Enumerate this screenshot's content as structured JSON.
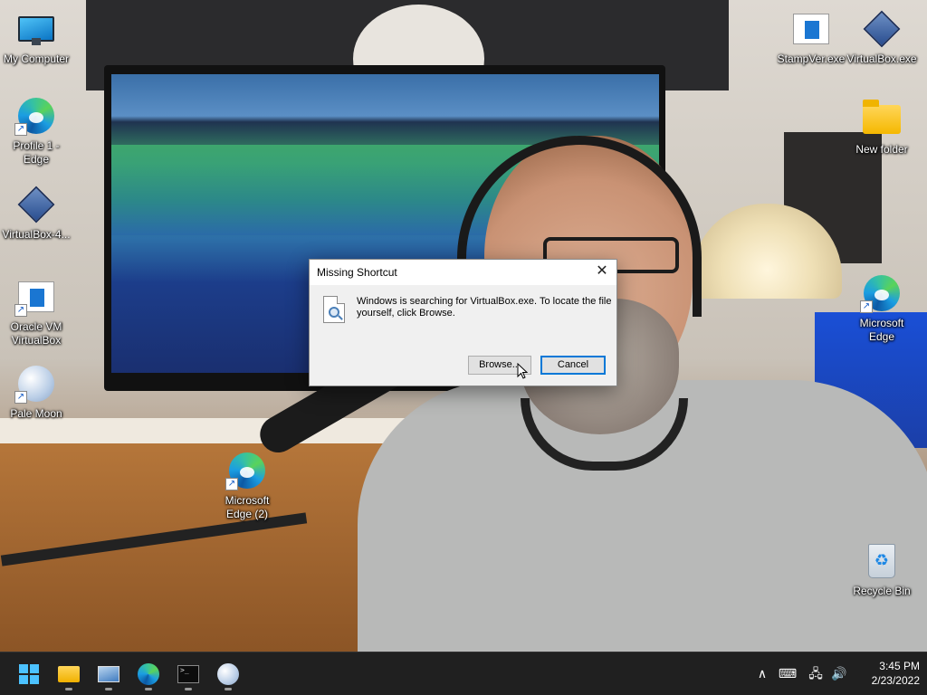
{
  "desktop": {
    "icons": [
      {
        "label": "My Computer",
        "icon": "monitor-icon"
      },
      {
        "label": "Profile 1 - Edge",
        "icon": "edge-icon"
      },
      {
        "label": "VirtualBox-4...",
        "icon": "virtualbox-icon"
      },
      {
        "label": "Oracle VM VirtualBox",
        "icon": "oracle-vm-icon"
      },
      {
        "label": "Pale Moon",
        "icon": "pale-moon-icon"
      },
      {
        "label": "Microsoft Edge (2)",
        "icon": "edge-icon"
      },
      {
        "label": "StampVer.exe",
        "icon": "exe-icon"
      },
      {
        "label": "VirtualBox.exe",
        "icon": "virtualbox-icon"
      },
      {
        "label": "New folder",
        "icon": "folder-icon"
      },
      {
        "label": "Microsoft Edge",
        "icon": "edge-icon"
      },
      {
        "label": "Recycle Bin",
        "icon": "recycle-bin-icon"
      }
    ]
  },
  "dialog": {
    "title": "Missing Shortcut",
    "message": "Windows is searching for VirtualBox.exe. To locate the file yourself, click Browse.",
    "browse_label": "Browse...",
    "cancel_label": "Cancel",
    "close_glyph": "✕"
  },
  "taskbar": {
    "apps": [
      {
        "name": "Start",
        "icon": "windows-start-icon"
      },
      {
        "name": "File Explorer",
        "icon": "folder-icon"
      },
      {
        "name": "Task Manager",
        "icon": "monitor-icon"
      },
      {
        "name": "Microsoft Edge",
        "icon": "edge-icon"
      },
      {
        "name": "Terminal",
        "icon": "terminal-icon"
      },
      {
        "name": "Pale Moon",
        "icon": "pale-moon-icon"
      }
    ],
    "tray": {
      "chevron": "∧",
      "keyboard": "⌨",
      "network": "🖧",
      "volume": "🔊"
    },
    "clock": {
      "time": "3:45 PM",
      "date": "2/23/2022"
    }
  },
  "colors": {
    "accent": "#0078d7",
    "taskbar": "#202020",
    "dialog_bg": "#f0f0f0"
  }
}
